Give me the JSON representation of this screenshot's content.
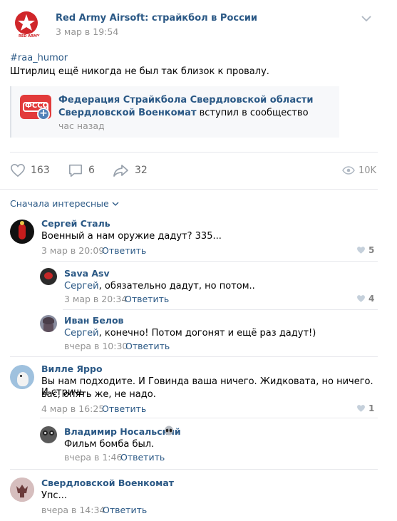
{
  "post": {
    "author": "Red Army Airsoft: страйкбол в России",
    "date": "3 мар в 19:54",
    "hashtag": "#raa_humor",
    "text": "Штирлиц ещё никогда не был так близок к провалу.",
    "logo_text": "RED ARMY"
  },
  "repost": {
    "group": "Федерация Страйкбола Свердловской области",
    "actor": "Свердловской Военкомат",
    "action": " вступил в сообщество",
    "time": "час назад",
    "logo_text": "ФССО"
  },
  "actions": {
    "likes": "163",
    "comments": "6",
    "shares": "32",
    "views": "10K"
  },
  "sort_label": "Сначала интересные",
  "reply_label": "Ответить",
  "comments": [
    {
      "author": "Сергей Сталь",
      "text": "Военный а нам оружие дадут? 335...",
      "date": "3 мар в 20:09",
      "likes": "5"
    },
    {
      "author": "Sava Asv",
      "mention": "Сергей",
      "text": ", обязательно дадут, но потом..",
      "date": "3 мар в 20:34",
      "likes": "4"
    },
    {
      "author": "Иван Белов",
      "mention": "Сергей",
      "text": ", конечно! Потом догонят и ещё раз дадут!)",
      "date": "вчера в 10:30",
      "likes": ""
    },
    {
      "author": "Вилле Ярро",
      "text_line1": "Вы нам подходите. И Говинда ваша ничего. Жидковата, но ничего. И стричь",
      "text_line2": "вас, опять же, не надо.",
      "date": "4 мар в 16:25",
      "likes": "1"
    },
    {
      "author": "Владимир Носальский",
      "text": "Фильм бомба был.",
      "date": "вчера в 1:46",
      "likes": ""
    },
    {
      "author": "Свердловской Военкомат",
      "text": "Упс...",
      "date": "вчера в 14:34",
      "likes": ""
    }
  ],
  "colors": {
    "accent": "#2a5885",
    "muted": "#939393",
    "divider": "#e7e8ec",
    "repost_bg": "#f7f8fa",
    "brand_red": "#d0262a"
  }
}
